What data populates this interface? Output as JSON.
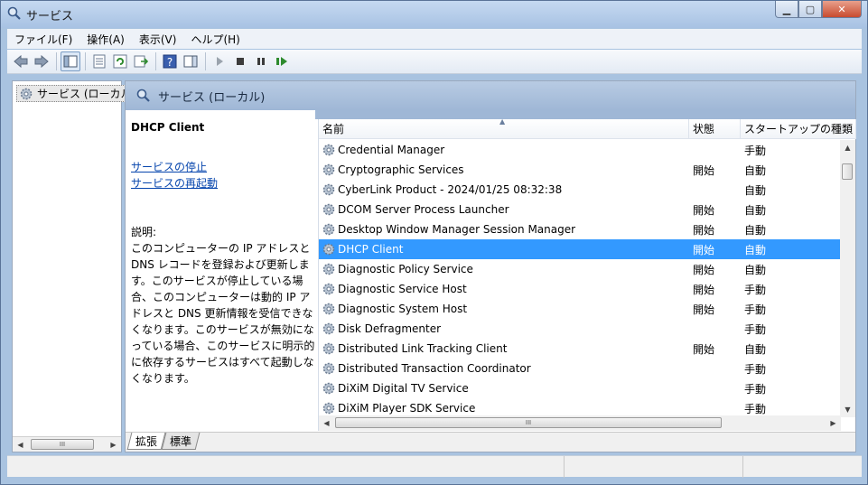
{
  "window": {
    "title": "サービス",
    "controls": {
      "minimize": "▁",
      "maximize": "▢",
      "close": "✕"
    }
  },
  "menu": [
    {
      "label": "ファイル(F)"
    },
    {
      "label": "操作(A)"
    },
    {
      "label": "表示(V)"
    },
    {
      "label": "ヘルプ(H)"
    }
  ],
  "tree": {
    "root_label": "サービス (ローカル)"
  },
  "header": {
    "title": "サービス (ローカル)"
  },
  "details": {
    "service_name": "DHCP Client",
    "stop_link": "サービスの停止",
    "restart_link": "サービスの再起動",
    "description_label": "説明:",
    "description": "このコンピューターの IP アドレスと DNS レコードを登録および更新します。このサービスが停止している場合、このコンピューターは動的 IP アドレスと DNS 更新情報を受信できなくなります。このサービスが無効になっている場合、このサービスに明示的に依存するサービスはすべて起動しなくなります。"
  },
  "columns": {
    "name": "名前",
    "status": "状態",
    "startup": "スタートアップの種類"
  },
  "services": [
    {
      "name": "Credential Manager",
      "status": "",
      "startup": "手動"
    },
    {
      "name": "Cryptographic Services",
      "status": "開始",
      "startup": "自動"
    },
    {
      "name": "CyberLink Product - 2024/01/25 08:32:38",
      "status": "",
      "startup": "自動"
    },
    {
      "name": "DCOM Server Process Launcher",
      "status": "開始",
      "startup": "自動"
    },
    {
      "name": "Desktop Window Manager Session Manager",
      "status": "開始",
      "startup": "自動"
    },
    {
      "name": "DHCP Client",
      "status": "開始",
      "startup": "自動",
      "selected": true
    },
    {
      "name": "Diagnostic Policy Service",
      "status": "開始",
      "startup": "自動"
    },
    {
      "name": "Diagnostic Service Host",
      "status": "開始",
      "startup": "手動"
    },
    {
      "name": "Diagnostic System Host",
      "status": "開始",
      "startup": "手動"
    },
    {
      "name": "Disk Defragmenter",
      "status": "",
      "startup": "手動"
    },
    {
      "name": "Distributed Link Tracking Client",
      "status": "開始",
      "startup": "自動"
    },
    {
      "name": "Distributed Transaction Coordinator",
      "status": "",
      "startup": "手動"
    },
    {
      "name": "DiXiM Digital TV Service",
      "status": "",
      "startup": "手動"
    },
    {
      "name": "DiXiM Player SDK Service",
      "status": "",
      "startup": "手動"
    }
  ],
  "tabs": [
    {
      "label": "拡張"
    },
    {
      "label": "標準"
    }
  ],
  "scroll_glyph": "III",
  "colors": {
    "selection": "#3399ff",
    "header_band": "#9fb7d6",
    "link": "#0645ad"
  }
}
